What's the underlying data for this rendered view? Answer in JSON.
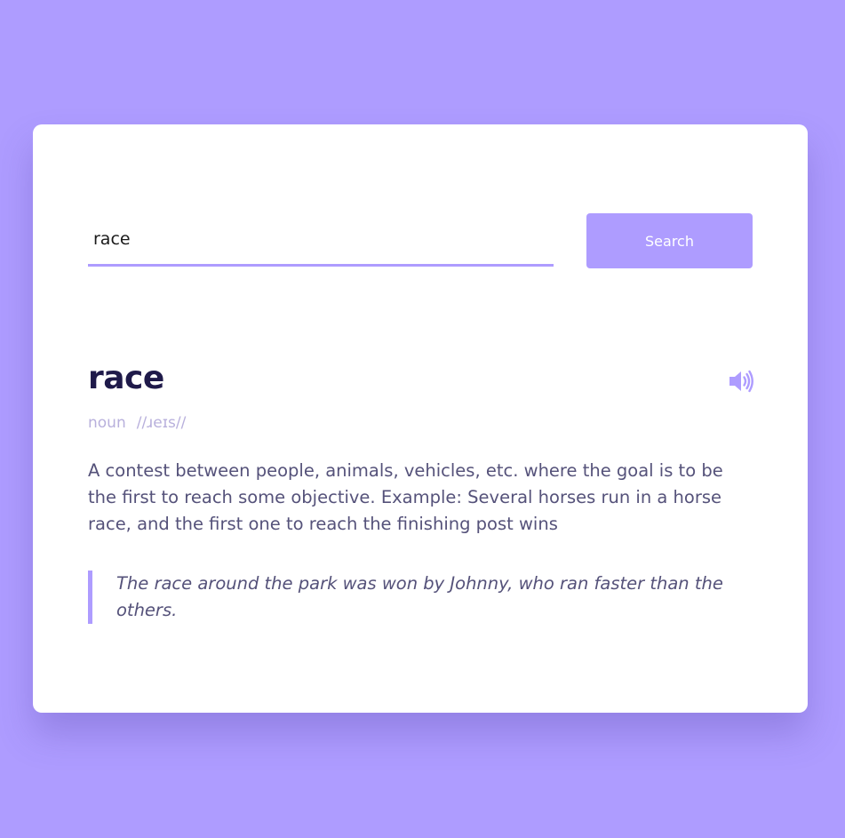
{
  "search": {
    "value": "race",
    "button_label": "Search"
  },
  "entry": {
    "word": "race",
    "part_of_speech": "noun",
    "phonetic": "//ɹeɪs//",
    "definition": "A contest between people, animals, vehicles, etc. where the goal is to be the first to reach some objective. Example: Several horses run in a horse race, and the first one to reach the finishing post wins",
    "example": "The race around the park was won by Johnny, who ran faster than the others."
  },
  "icons": {
    "sound": "speaker-volume-icon"
  },
  "colors": {
    "background": "#ae9cff",
    "accent": "#ae9cff",
    "title": "#1f1a4a",
    "body_text": "#55527a",
    "muted": "#b8b0dc"
  }
}
